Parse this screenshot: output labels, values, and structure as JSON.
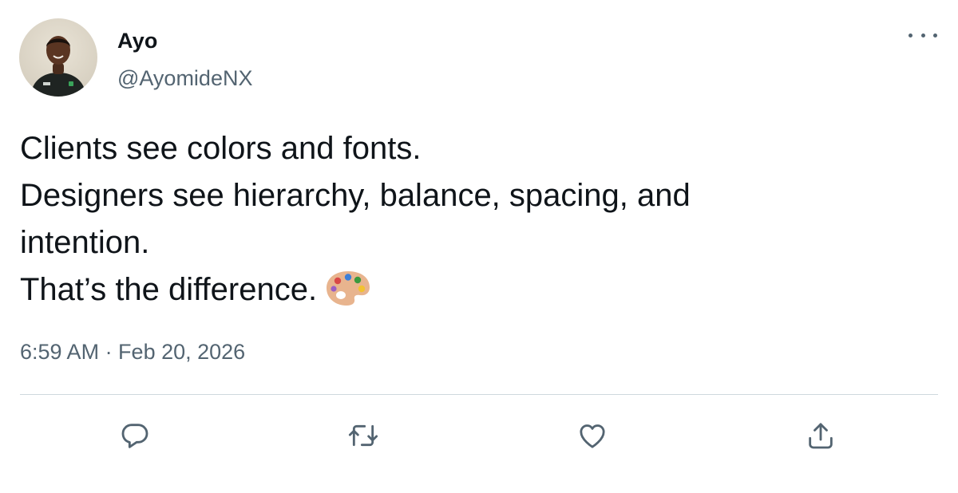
{
  "author": {
    "name": "Ayo",
    "handle": "@AyomideNX",
    "avatar_icon": "profile-photo"
  },
  "tweet": {
    "lines": [
      "Clients see colors and fonts.",
      "Designers see hierarchy, balance, spacing, and",
      "intention.",
      "That’s the difference."
    ],
    "emoji": "artist-palette-icon",
    "timestamp": "6:59 AM · Feb 20, 2026"
  },
  "actions": {
    "reply_icon": "reply-icon",
    "retweet_icon": "retweet-icon",
    "like_icon": "heart-icon",
    "share_icon": "share-icon",
    "more_icon": "more-options-icon"
  },
  "colors": {
    "text_primary": "#0f1419",
    "text_secondary": "#536471",
    "divider": "#cfd9de"
  }
}
